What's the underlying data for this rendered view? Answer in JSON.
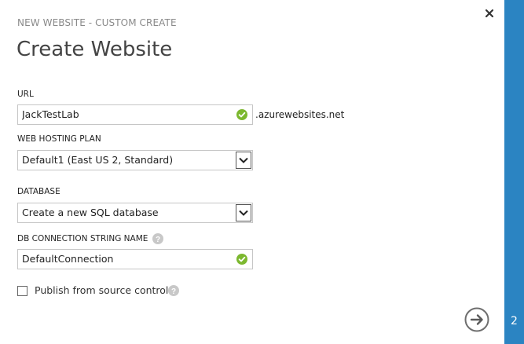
{
  "header": {
    "subtitle": "NEW WEBSITE - CUSTOM CREATE",
    "title": "Create Website"
  },
  "form": {
    "url": {
      "label": "URL",
      "value": "JackTestLab",
      "suffix": ".azurewebsites.net",
      "status_icon": "check-circle-icon"
    },
    "hosting_plan": {
      "label": "WEB HOSTING PLAN",
      "selected": "Default1 (East US 2, Standard)"
    },
    "database": {
      "label": "DATABASE",
      "selected": "Create a new SQL database"
    },
    "connection_string": {
      "label": "DB CONNECTION STRING NAME",
      "value": "DefaultConnection",
      "status_icon": "check-circle-icon"
    },
    "publish": {
      "label": "Publish from source control",
      "checked": false
    }
  },
  "steps": {
    "current": "2"
  },
  "colors": {
    "accent": "#2b84c2",
    "success": "#7cb82f",
    "help": "#c8c8c8"
  }
}
